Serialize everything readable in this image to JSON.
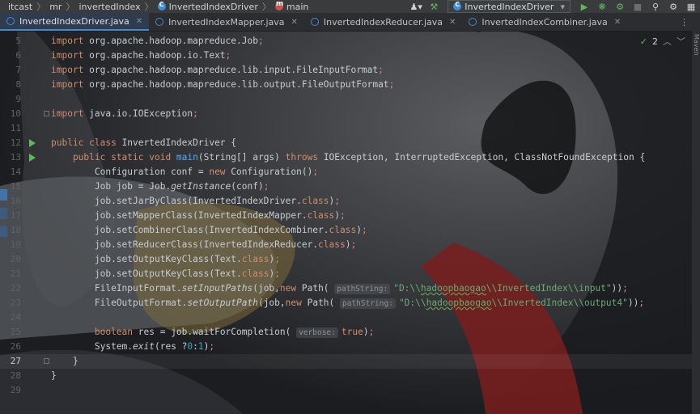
{
  "navbar": {
    "crumbs": [
      "itcast",
      "mr",
      "invertedIndex",
      "InvertedIndexDriver",
      "main"
    ],
    "run_config": "InvertedIndexDriver"
  },
  "tabs": [
    {
      "label": "InvertedIndexDriver.java",
      "active": true
    },
    {
      "label": "InvertedIndexMapper.java",
      "active": false
    },
    {
      "label": "InvertedIndexReducer.java",
      "active": false
    },
    {
      "label": "InvertedIndexCombiner.java",
      "active": false
    }
  ],
  "inspection": {
    "count": "2"
  },
  "right_tool_window": "Maven",
  "code_lines": [
    {
      "n": "5",
      "tokens": [
        {
          "t": "import ",
          "c": "kw"
        },
        {
          "t": "org.apache.hadoop.mapreduce.Job",
          "c": ""
        },
        {
          "t": ";",
          "c": "kw"
        }
      ]
    },
    {
      "n": "6",
      "tokens": [
        {
          "t": "import ",
          "c": "kw"
        },
        {
          "t": "org.apache.hadoop.io.Text",
          "c": ""
        },
        {
          "t": ";",
          "c": "kw"
        }
      ]
    },
    {
      "n": "7",
      "tokens": [
        {
          "t": "import ",
          "c": "kw"
        },
        {
          "t": "org.apache.hadoop.mapreduce.lib.input.FileInputFormat",
          "c": ""
        },
        {
          "t": ";",
          "c": "kw"
        }
      ]
    },
    {
      "n": "8",
      "tokens": [
        {
          "t": "import ",
          "c": "kw"
        },
        {
          "t": "org.apache.hadoop.mapreduce.lib.output.FileOutputFormat",
          "c": ""
        },
        {
          "t": ";",
          "c": "kw"
        }
      ]
    },
    {
      "n": "9",
      "tokens": []
    },
    {
      "n": "10",
      "tokens": [
        {
          "t": "import ",
          "c": "kw"
        },
        {
          "t": "java.io.IOException",
          "c": ""
        },
        {
          "t": ";",
          "c": "kw"
        }
      ]
    },
    {
      "n": "11",
      "tokens": []
    },
    {
      "n": "12",
      "tokens": [
        {
          "t": "public class ",
          "c": "kw"
        },
        {
          "t": "InvertedIndexDriver {",
          "c": ""
        }
      ]
    },
    {
      "n": "13",
      "tokens": [
        {
          "t": "    public static void ",
          "c": "kw"
        },
        {
          "t": "main",
          "c": "fn"
        },
        {
          "t": "(String[] args) ",
          "c": ""
        },
        {
          "t": "throws ",
          "c": "kw"
        },
        {
          "t": "IOException, InterruptedException, ClassNotFoundException {",
          "c": ""
        }
      ]
    },
    {
      "n": "14",
      "tokens": [
        {
          "t": "        Configuration conf = ",
          "c": ""
        },
        {
          "t": "new ",
          "c": "kw"
        },
        {
          "t": "Configuration()",
          "c": ""
        },
        {
          "t": ";",
          "c": "kw"
        }
      ]
    },
    {
      "n": "15",
      "tokens": [
        {
          "t": "        Job job = Job.",
          "c": ""
        },
        {
          "t": "getInstance",
          "c": "ital"
        },
        {
          "t": "(conf)",
          "c": ""
        },
        {
          "t": ";",
          "c": "kw"
        }
      ]
    },
    {
      "n": "16",
      "tokens": [
        {
          "t": "        job.setJarByClass(InvertedIndexDriver.",
          "c": ""
        },
        {
          "t": "class",
          "c": "kw"
        },
        {
          "t": ")",
          "c": ""
        },
        {
          "t": ";",
          "c": "kw"
        }
      ]
    },
    {
      "n": "17",
      "tokens": [
        {
          "t": "        job.setMapperClass(InvertedIndexMapper.",
          "c": ""
        },
        {
          "t": "class",
          "c": "kw"
        },
        {
          "t": ")",
          "c": ""
        },
        {
          "t": ";",
          "c": "kw"
        }
      ]
    },
    {
      "n": "18",
      "tokens": [
        {
          "t": "        job.setCombinerClass(InvertedIndexCombiner.",
          "c": ""
        },
        {
          "t": "class",
          "c": "kw"
        },
        {
          "t": ")",
          "c": ""
        },
        {
          "t": ";",
          "c": "kw"
        }
      ]
    },
    {
      "n": "19",
      "tokens": [
        {
          "t": "        job.setReducerClass(InvertedIndexReducer.",
          "c": ""
        },
        {
          "t": "class",
          "c": "kw"
        },
        {
          "t": ")",
          "c": ""
        },
        {
          "t": ";",
          "c": "kw"
        }
      ]
    },
    {
      "n": "20",
      "tokens": [
        {
          "t": "        job.setOutputKeyClass(Text.",
          "c": ""
        },
        {
          "t": "class",
          "c": "kw"
        },
        {
          "t": ")",
          "c": ""
        },
        {
          "t": ";",
          "c": "kw"
        }
      ]
    },
    {
      "n": "21",
      "tokens": [
        {
          "t": "        job.setOutputKeyClass(Text.",
          "c": ""
        },
        {
          "t": "class",
          "c": "kw"
        },
        {
          "t": ")",
          "c": ""
        },
        {
          "t": ";",
          "c": "kw"
        }
      ]
    },
    {
      "n": "22",
      "tokens": [
        {
          "t": "        FileInputFormat.",
          "c": ""
        },
        {
          "t": "setInputPaths",
          "c": "ital"
        },
        {
          "t": "(job,",
          "c": ""
        },
        {
          "t": "new ",
          "c": "kw"
        },
        {
          "t": "Path( ",
          "c": ""
        },
        {
          "t": "pathString:",
          "c": "hint"
        },
        {
          "t": "\"D:\\\\",
          "c": "str"
        },
        {
          "t": "hadoopbaogao",
          "c": "str typo"
        },
        {
          "t": "\\\\InvertedIndex\\\\input\"",
          "c": "str"
        },
        {
          "t": "))",
          "c": ""
        },
        {
          "t": ";",
          "c": "kw"
        }
      ]
    },
    {
      "n": "23",
      "tokens": [
        {
          "t": "        FileOutputFormat.",
          "c": ""
        },
        {
          "t": "setOutputPath",
          "c": "ital"
        },
        {
          "t": "(job,",
          "c": ""
        },
        {
          "t": "new ",
          "c": "kw"
        },
        {
          "t": "Path( ",
          "c": ""
        },
        {
          "t": "pathString:",
          "c": "hint"
        },
        {
          "t": "\"D:\\\\",
          "c": "str"
        },
        {
          "t": "hadoopbaogao",
          "c": "str typo"
        },
        {
          "t": "\\\\InvertedIndex\\\\output4\"",
          "c": "str"
        },
        {
          "t": "))",
          "c": ""
        },
        {
          "t": ";",
          "c": "kw"
        }
      ]
    },
    {
      "n": "24",
      "tokens": []
    },
    {
      "n": "25",
      "tokens": [
        {
          "t": "        boolean ",
          "c": "kw"
        },
        {
          "t": "res = job.waitForCompletion( ",
          "c": ""
        },
        {
          "t": "verbose:",
          "c": "hint"
        },
        {
          "t": "true",
          "c": "kw"
        },
        {
          "t": ")",
          "c": ""
        },
        {
          "t": ";",
          "c": "kw"
        }
      ]
    },
    {
      "n": "26",
      "tokens": [
        {
          "t": "        System.",
          "c": ""
        },
        {
          "t": "exit",
          "c": "ital"
        },
        {
          "t": "(res ?",
          "c": ""
        },
        {
          "t": "0",
          "c": "num"
        },
        {
          "t": ":",
          "c": ""
        },
        {
          "t": "1",
          "c": "num"
        },
        {
          "t": ")",
          "c": ""
        },
        {
          "t": ";",
          "c": "kw"
        }
      ]
    },
    {
      "n": "27",
      "tokens": [
        {
          "t": "    }",
          "c": ""
        }
      ]
    },
    {
      "n": "28",
      "tokens": [
        {
          "t": "}",
          "c": ""
        }
      ]
    },
    {
      "n": "29",
      "tokens": []
    }
  ]
}
